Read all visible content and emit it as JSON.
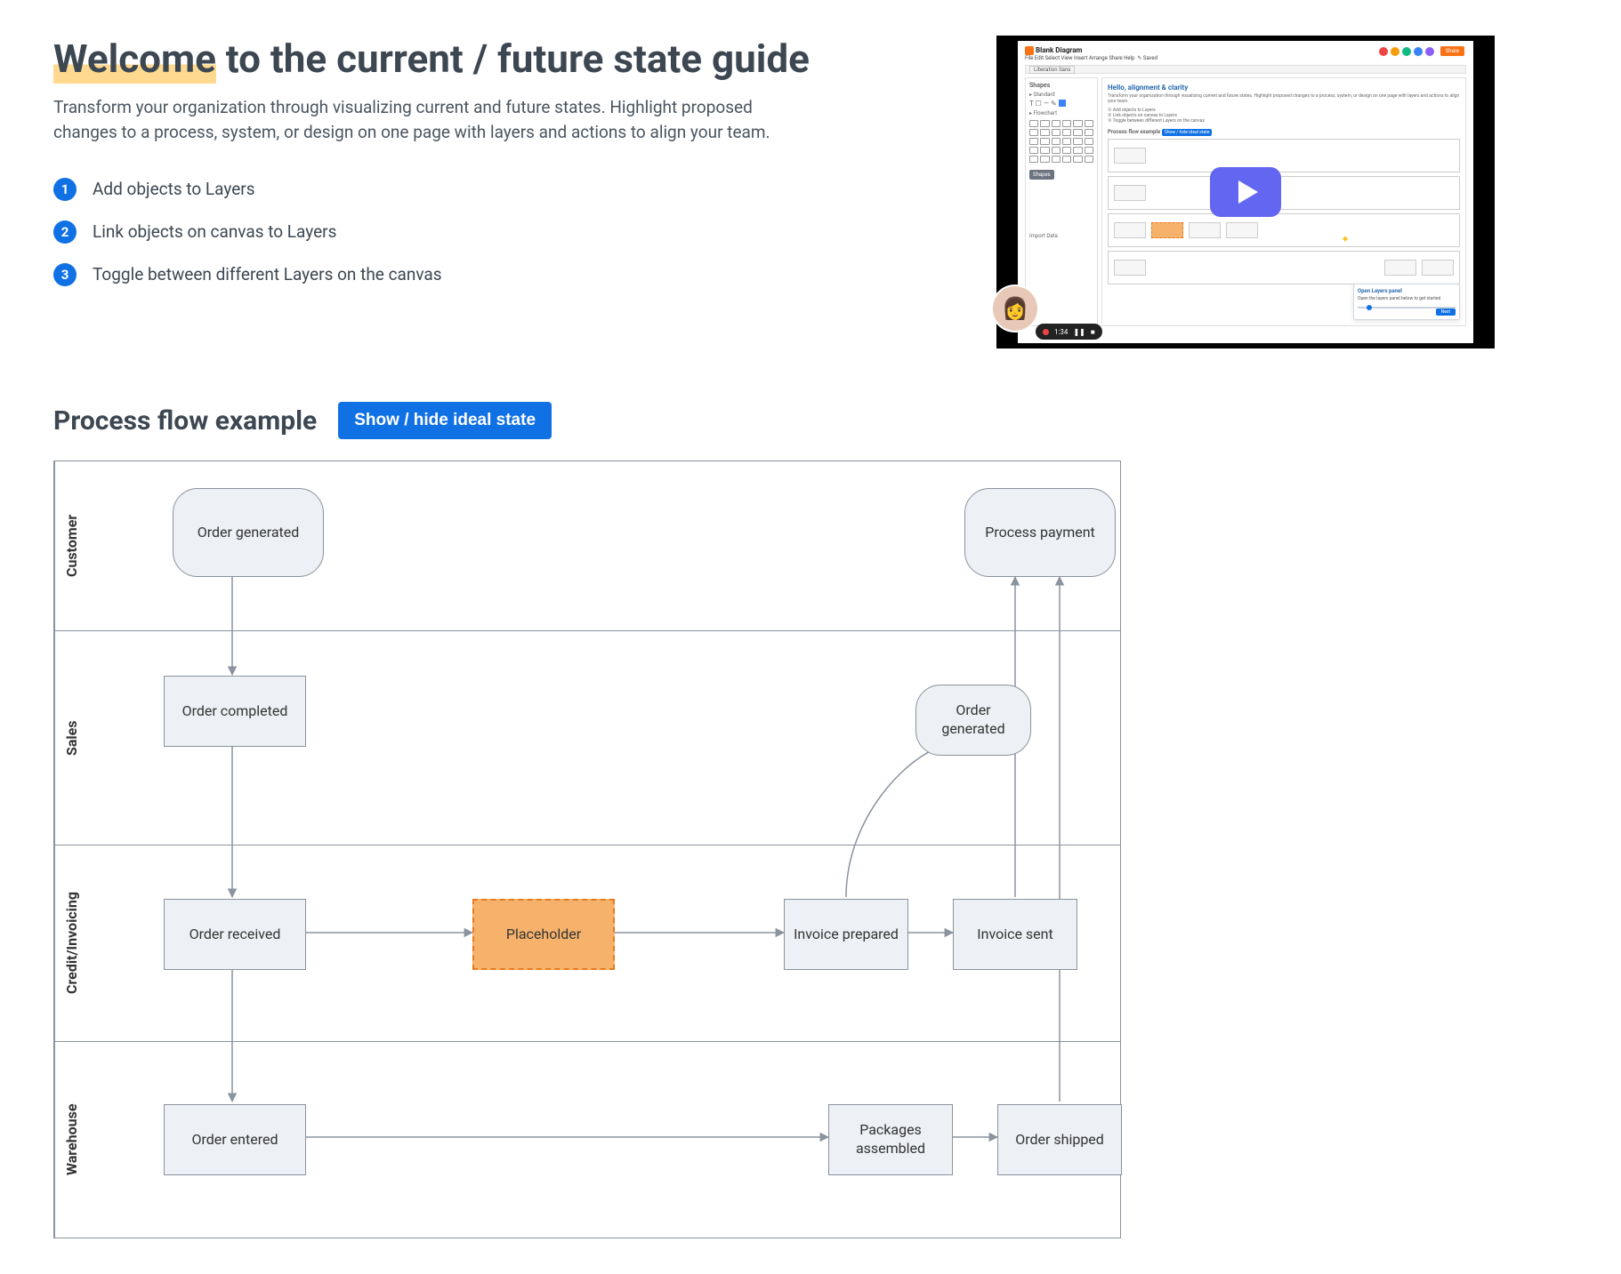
{
  "header": {
    "title_highlight": "Welcome",
    "title_rest": " to the current / future state guide",
    "lead": "Transform your organization through visualizing current and future states. Highlight proposed changes to a process, system, or design on one page with layers and actions to align your team."
  },
  "steps": [
    {
      "num": "1",
      "text": "Add objects to Layers"
    },
    {
      "num": "2",
      "text": "Link objects on canvas to Layers"
    },
    {
      "num": "3",
      "text": "Toggle between different Layers on the canvas"
    }
  ],
  "video": {
    "doc_title": "Blank Diagram",
    "menu": "File  Edit  Select  View  Insert  Arrange  Share  Help",
    "autosave": "Saved",
    "shapes_panel_title": "Shapes",
    "shapes_section_standard": "Standard",
    "shapes_section_flowchart": "Flowchart",
    "shapes_button": "Shapes",
    "import_button": "Import Data",
    "canvas_heading": "Hello, alignment & clarity",
    "canvas_sub": "Transform your organization through visualizing current and future states. Highlight proposed changes to a process, system, or design on one page with layers and actions to align your team.",
    "canvas_step1": "Add objects to Layers",
    "canvas_step2": "Link objects on canvas to Layers",
    "canvas_step3": "Toggle between different Layers on the canvas",
    "canvas_section": "Process flow example",
    "canvas_btn": "Show / hide ideal state",
    "popup_title": "Open Layers panel",
    "popup_body": "Open the layers panel below to get started",
    "popup_btn": "Next",
    "share": "Share",
    "rec_time": "1:34",
    "font_dropdown": "Liberation Sans"
  },
  "section": {
    "title": "Process flow example",
    "toggle": "Show / hide ideal state"
  },
  "lanes": {
    "customer": "Customer",
    "sales": "Sales",
    "credit": "Credit/Invoicing",
    "warehouse": "Warehouse"
  },
  "nodes": {
    "order_generated_customer": "Order generated",
    "process_payment": "Process payment",
    "order_completed": "Order completed",
    "order_generated_sales": "Order generated",
    "order_received": "Order received",
    "placeholder": "Placeholder",
    "invoice_prepared": "Invoice prepared",
    "invoice_sent": "Invoice sent",
    "order_entered": "Order entered",
    "packages_assembled": "Packages assembled",
    "order_shipped": "Order shipped"
  },
  "chart_data": {
    "type": "swimlane-flow",
    "lanes": [
      "Customer",
      "Sales",
      "Credit/Invoicing",
      "Warehouse"
    ],
    "nodes": [
      {
        "id": "order_generated_customer",
        "lane": "Customer",
        "label": "Order generated",
        "shape": "rounded"
      },
      {
        "id": "process_payment",
        "lane": "Customer",
        "label": "Process payment",
        "shape": "rounded"
      },
      {
        "id": "order_completed",
        "lane": "Sales",
        "label": "Order completed",
        "shape": "rect"
      },
      {
        "id": "order_generated_sales",
        "lane": "Sales",
        "label": "Order generated",
        "shape": "rounded"
      },
      {
        "id": "order_received",
        "lane": "Credit/Invoicing",
        "label": "Order received",
        "shape": "rect"
      },
      {
        "id": "placeholder",
        "lane": "Credit/Invoicing",
        "label": "Placeholder",
        "shape": "rect",
        "variant": "placeholder"
      },
      {
        "id": "invoice_prepared",
        "lane": "Credit/Invoicing",
        "label": "Invoice prepared",
        "shape": "rect"
      },
      {
        "id": "invoice_sent",
        "lane": "Credit/Invoicing",
        "label": "Invoice sent",
        "shape": "rect"
      },
      {
        "id": "order_entered",
        "lane": "Warehouse",
        "label": "Order entered",
        "shape": "rect"
      },
      {
        "id": "packages_assembled",
        "lane": "Warehouse",
        "label": "Packages assembled",
        "shape": "rect"
      },
      {
        "id": "order_shipped",
        "lane": "Warehouse",
        "label": "Order shipped",
        "shape": "rect"
      }
    ],
    "edges": [
      {
        "from": "order_generated_customer",
        "to": "order_completed"
      },
      {
        "from": "order_completed",
        "to": "order_received"
      },
      {
        "from": "order_received",
        "to": "placeholder"
      },
      {
        "from": "placeholder",
        "to": "invoice_prepared"
      },
      {
        "from": "invoice_prepared",
        "to": "invoice_sent"
      },
      {
        "from": "invoice_prepared",
        "to": "order_generated_sales",
        "style": "curve"
      },
      {
        "from": "order_received",
        "to": "order_entered"
      },
      {
        "from": "order_entered",
        "to": "packages_assembled"
      },
      {
        "from": "packages_assembled",
        "to": "order_shipped"
      },
      {
        "from": "invoice_sent",
        "to": "process_payment"
      },
      {
        "from": "order_shipped",
        "to": "process_payment"
      }
    ]
  }
}
